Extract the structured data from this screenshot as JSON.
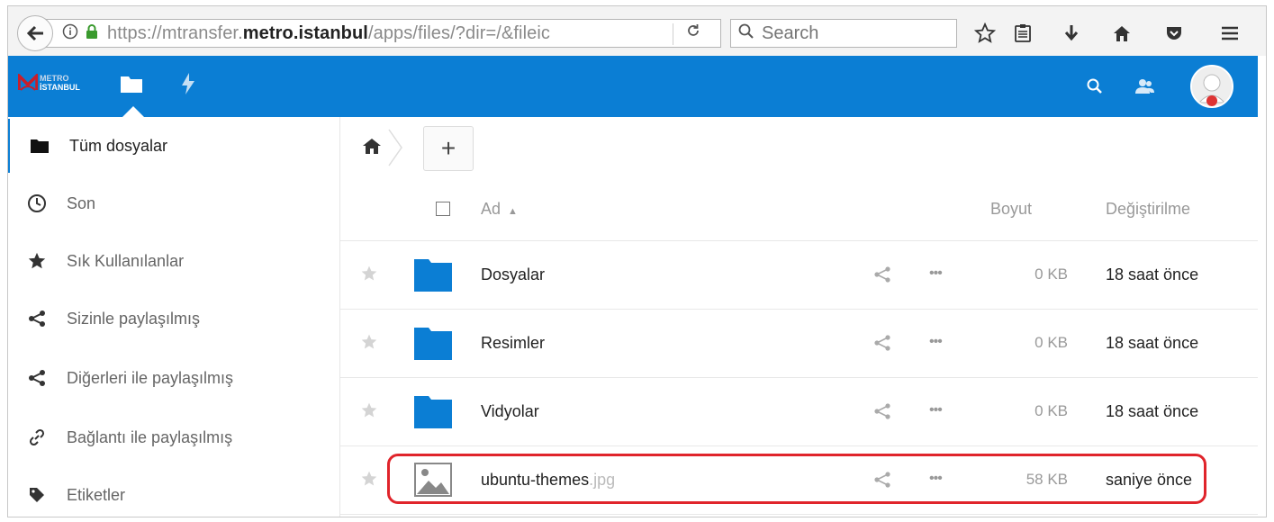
{
  "browser": {
    "url_prefix": "https://mtransfer.",
    "url_domain": "metro.istanbul",
    "url_path": "/apps/files/?dir=/&fileic",
    "search_placeholder": "Search"
  },
  "header": {
    "logo_line1": "METRO",
    "logo_line2": "İSTANBUL",
    "accent_color": "#0b7ed4"
  },
  "sidebar": {
    "items": [
      {
        "label": "Tüm dosyalar",
        "icon": "folder-icon"
      },
      {
        "label": "Son",
        "icon": "clock-icon"
      },
      {
        "label": "Sık Kullanılanlar",
        "icon": "star-icon"
      },
      {
        "label": "Sizinle paylaşılmış",
        "icon": "share-icon"
      },
      {
        "label": "Diğerleri ile paylaşılmış",
        "icon": "share-icon"
      },
      {
        "label": "Bağlantı ile paylaşılmış",
        "icon": "link-icon"
      },
      {
        "label": "Etiketler",
        "icon": "tag-icon"
      }
    ]
  },
  "toolbar": {
    "add_label": "+"
  },
  "table": {
    "columns": {
      "name": "Ad",
      "sort_indicator": "▲",
      "size": "Boyut",
      "modified": "Değiştirilme"
    },
    "rows": [
      {
        "name": "Dosyalar",
        "ext": "",
        "type": "folder",
        "size": "0 KB",
        "modified": "18 saat önce"
      },
      {
        "name": "Resimler",
        "ext": "",
        "type": "folder",
        "size": "0 KB",
        "modified": "18 saat önce"
      },
      {
        "name": "Vidyolar",
        "ext": "",
        "type": "folder",
        "size": "0 KB",
        "modified": "18 saat önce"
      },
      {
        "name": "ubuntu-themes",
        "ext": ".jpg",
        "type": "image",
        "size": "58 KB",
        "modified": "saniye önce"
      }
    ],
    "menu_glyph": "•••"
  },
  "highlight_color": "#e0242b"
}
